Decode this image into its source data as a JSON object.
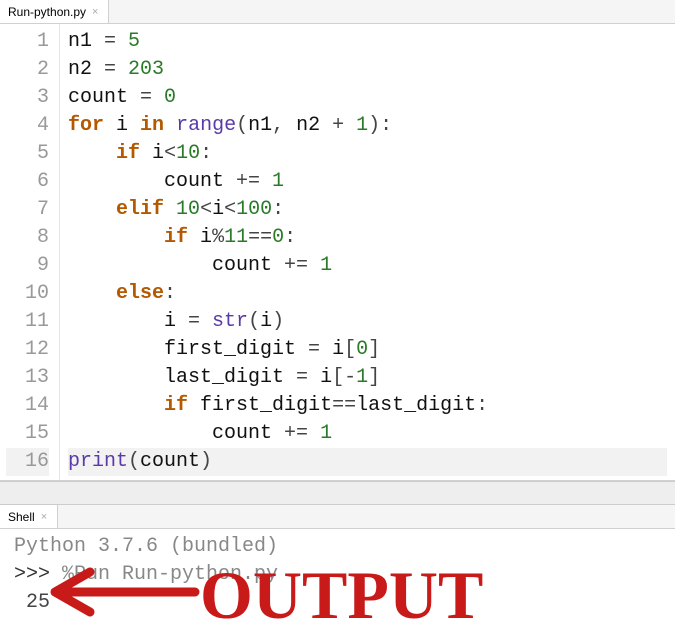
{
  "editor": {
    "tab_label": "Run-python.py",
    "lines": [
      {
        "n": "1",
        "tokens": [
          [
            "id",
            "n1"
          ],
          [
            "op",
            " = "
          ],
          [
            "num",
            "5"
          ]
        ]
      },
      {
        "n": "2",
        "tokens": [
          [
            "id",
            "n2"
          ],
          [
            "op",
            " = "
          ],
          [
            "num",
            "203"
          ]
        ]
      },
      {
        "n": "3",
        "tokens": [
          [
            "id",
            "count"
          ],
          [
            "op",
            " = "
          ],
          [
            "num",
            "0"
          ]
        ]
      },
      {
        "n": "4",
        "tokens": [
          [
            "kw",
            "for"
          ],
          [
            "id",
            " i "
          ],
          [
            "kw",
            "in"
          ],
          [
            "op",
            " "
          ],
          [
            "fn",
            "range"
          ],
          [
            "op",
            "("
          ],
          [
            "id",
            "n1"
          ],
          [
            "op",
            ", "
          ],
          [
            "id",
            "n2"
          ],
          [
            "op",
            " + "
          ],
          [
            "num",
            "1"
          ],
          [
            "op",
            "):"
          ]
        ]
      },
      {
        "n": "5",
        "tokens": [
          [
            "op",
            "    "
          ],
          [
            "kw",
            "if"
          ],
          [
            "op",
            " "
          ],
          [
            "id",
            "i"
          ],
          [
            "op",
            "<"
          ],
          [
            "num",
            "10"
          ],
          [
            "op",
            ":"
          ]
        ]
      },
      {
        "n": "6",
        "tokens": [
          [
            "op",
            "        "
          ],
          [
            "id",
            "count"
          ],
          [
            "op",
            " += "
          ],
          [
            "num",
            "1"
          ]
        ]
      },
      {
        "n": "7",
        "tokens": [
          [
            "op",
            "    "
          ],
          [
            "kw",
            "elif"
          ],
          [
            "op",
            " "
          ],
          [
            "num",
            "10"
          ],
          [
            "op",
            "<"
          ],
          [
            "id",
            "i"
          ],
          [
            "op",
            "<"
          ],
          [
            "num",
            "100"
          ],
          [
            "op",
            ":"
          ]
        ]
      },
      {
        "n": "8",
        "tokens": [
          [
            "op",
            "        "
          ],
          [
            "kw",
            "if"
          ],
          [
            "op",
            " "
          ],
          [
            "id",
            "i"
          ],
          [
            "op",
            "%"
          ],
          [
            "num",
            "11"
          ],
          [
            "op",
            "=="
          ],
          [
            "num",
            "0"
          ],
          [
            "op",
            ":"
          ]
        ]
      },
      {
        "n": "9",
        "tokens": [
          [
            "op",
            "            "
          ],
          [
            "id",
            "count"
          ],
          [
            "op",
            " += "
          ],
          [
            "num",
            "1"
          ]
        ]
      },
      {
        "n": "10",
        "tokens": [
          [
            "op",
            "    "
          ],
          [
            "kw",
            "else"
          ],
          [
            "op",
            ":"
          ]
        ]
      },
      {
        "n": "11",
        "tokens": [
          [
            "op",
            "        "
          ],
          [
            "id",
            "i"
          ],
          [
            "op",
            " = "
          ],
          [
            "fn",
            "str"
          ],
          [
            "op",
            "("
          ],
          [
            "id",
            "i"
          ],
          [
            "op",
            ")"
          ]
        ]
      },
      {
        "n": "12",
        "tokens": [
          [
            "op",
            "        "
          ],
          [
            "id",
            "first_digit"
          ],
          [
            "op",
            " = "
          ],
          [
            "id",
            "i"
          ],
          [
            "op",
            "["
          ],
          [
            "num",
            "0"
          ],
          [
            "op",
            "]"
          ]
        ]
      },
      {
        "n": "13",
        "tokens": [
          [
            "op",
            "        "
          ],
          [
            "id",
            "last_digit"
          ],
          [
            "op",
            " = "
          ],
          [
            "id",
            "i"
          ],
          [
            "op",
            "["
          ],
          [
            "op",
            "-"
          ],
          [
            "num",
            "1"
          ],
          [
            "op",
            "]"
          ]
        ]
      },
      {
        "n": "14",
        "tokens": [
          [
            "op",
            "        "
          ],
          [
            "kw",
            "if"
          ],
          [
            "op",
            " "
          ],
          [
            "id",
            "first_digit"
          ],
          [
            "op",
            "=="
          ],
          [
            "id",
            "last_digit"
          ],
          [
            "op",
            ":"
          ]
        ]
      },
      {
        "n": "15",
        "tokens": [
          [
            "op",
            "            "
          ],
          [
            "id",
            "count"
          ],
          [
            "op",
            " += "
          ],
          [
            "num",
            "1"
          ]
        ]
      },
      {
        "n": "16",
        "tokens": [
          [
            "fn",
            "print"
          ],
          [
            "op",
            "("
          ],
          [
            "id",
            "count"
          ],
          [
            "op",
            ")"
          ]
        ],
        "hl": true
      }
    ]
  },
  "shell": {
    "tab_label": "Shell",
    "banner": "Python 3.7.6 (bundled)",
    "prompt": ">>> ",
    "command": "%Run Run-python.py",
    "output": " 25"
  },
  "annotation": {
    "text": "OUTPUT",
    "color": "#c91a1a"
  }
}
